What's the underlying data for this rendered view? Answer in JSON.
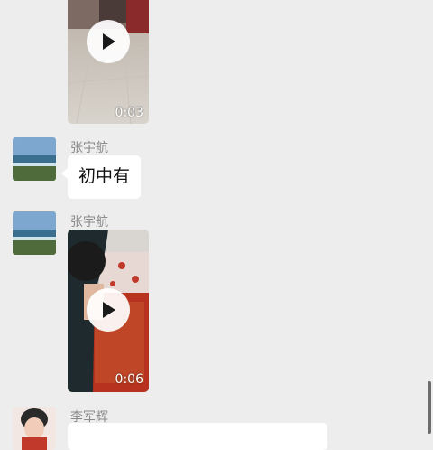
{
  "messages": [
    {
      "type": "video",
      "duration": "0:03"
    },
    {
      "type": "text",
      "sender": "张宇航",
      "text": "初中有"
    },
    {
      "type": "video",
      "sender": "张宇航",
      "duration": "0:06"
    },
    {
      "type": "text",
      "sender": "李军辉",
      "text": ""
    }
  ],
  "icons": {
    "play": "play-icon"
  },
  "colors": {
    "background": "#ededed",
    "bubble": "#ffffff",
    "name_text": "#8a8a8a"
  }
}
